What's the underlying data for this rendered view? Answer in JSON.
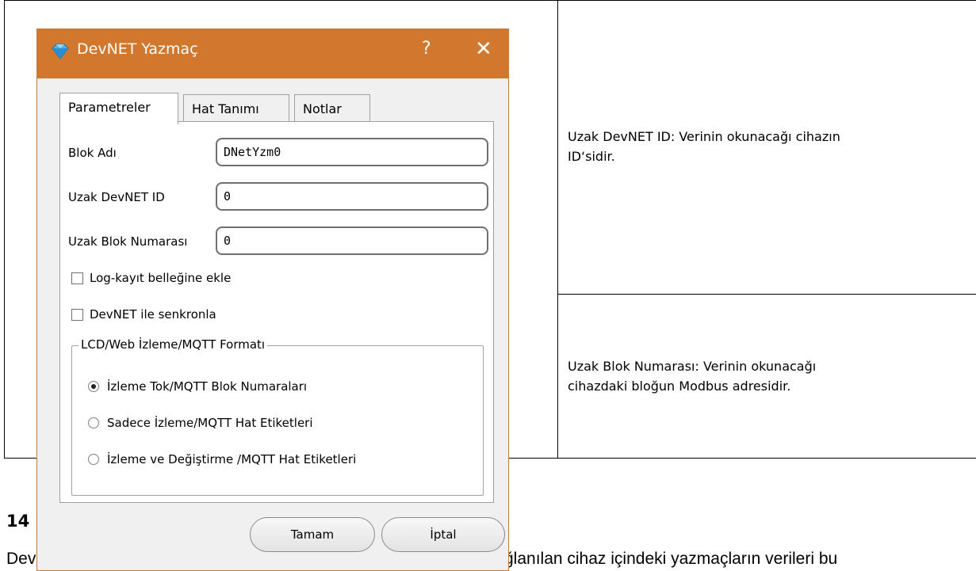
{
  "document": {
    "table_cells": [
      {
        "text_line1": "Uzak DevNET ID:  Verinin okunacağı cihazın",
        "text_line2": "ID‘sidir."
      },
      {
        "text_line1": "Uzak Blok Numarası:  Verinin okunacağı",
        "text_line2": "cihazdaki bloğun Modbus adresidir."
      }
    ],
    "section_heading": "14",
    "body_text_left": "Dev",
    "body_text_right": "ğlanılan cihaz içindeki yazmaçların verileri bu"
  },
  "dialog": {
    "title": "DevNET Yazmaç",
    "help_label": "?",
    "close_label": "✕",
    "tabs": [
      {
        "label": "Parametreler",
        "active": true
      },
      {
        "label": "Hat Tanımı",
        "active": false
      },
      {
        "label": "Notlar",
        "active": false
      }
    ],
    "fields": [
      {
        "label": "Blok Adı",
        "value": "DNetYzm0"
      },
      {
        "label": "Uzak DevNET ID",
        "value": "0"
      },
      {
        "label": "Uzak Blok Numarası",
        "value": "0"
      }
    ],
    "checkboxes": [
      {
        "label": "Log-kayıt belleğine ekle",
        "checked": false
      },
      {
        "label": "DevNET ile senkronla",
        "checked": false
      }
    ],
    "group": {
      "legend": "LCD/Web İzleme/MQTT Formatı",
      "options": [
        {
          "label": "İzleme Tok/MQTT Blok Numaraları",
          "checked": true
        },
        {
          "label": "Sadece İzleme/MQTT Hat Etiketleri",
          "checked": false
        },
        {
          "label": "İzleme ve Değiştirme /MQTT Hat Etiketleri",
          "checked": false
        }
      ]
    },
    "buttons": {
      "ok": "Tamam",
      "cancel": "İptal"
    },
    "colors": {
      "titlebar": "#d2772e",
      "panel": "#ffffff",
      "dialog_bg": "#f0f0f0"
    }
  }
}
